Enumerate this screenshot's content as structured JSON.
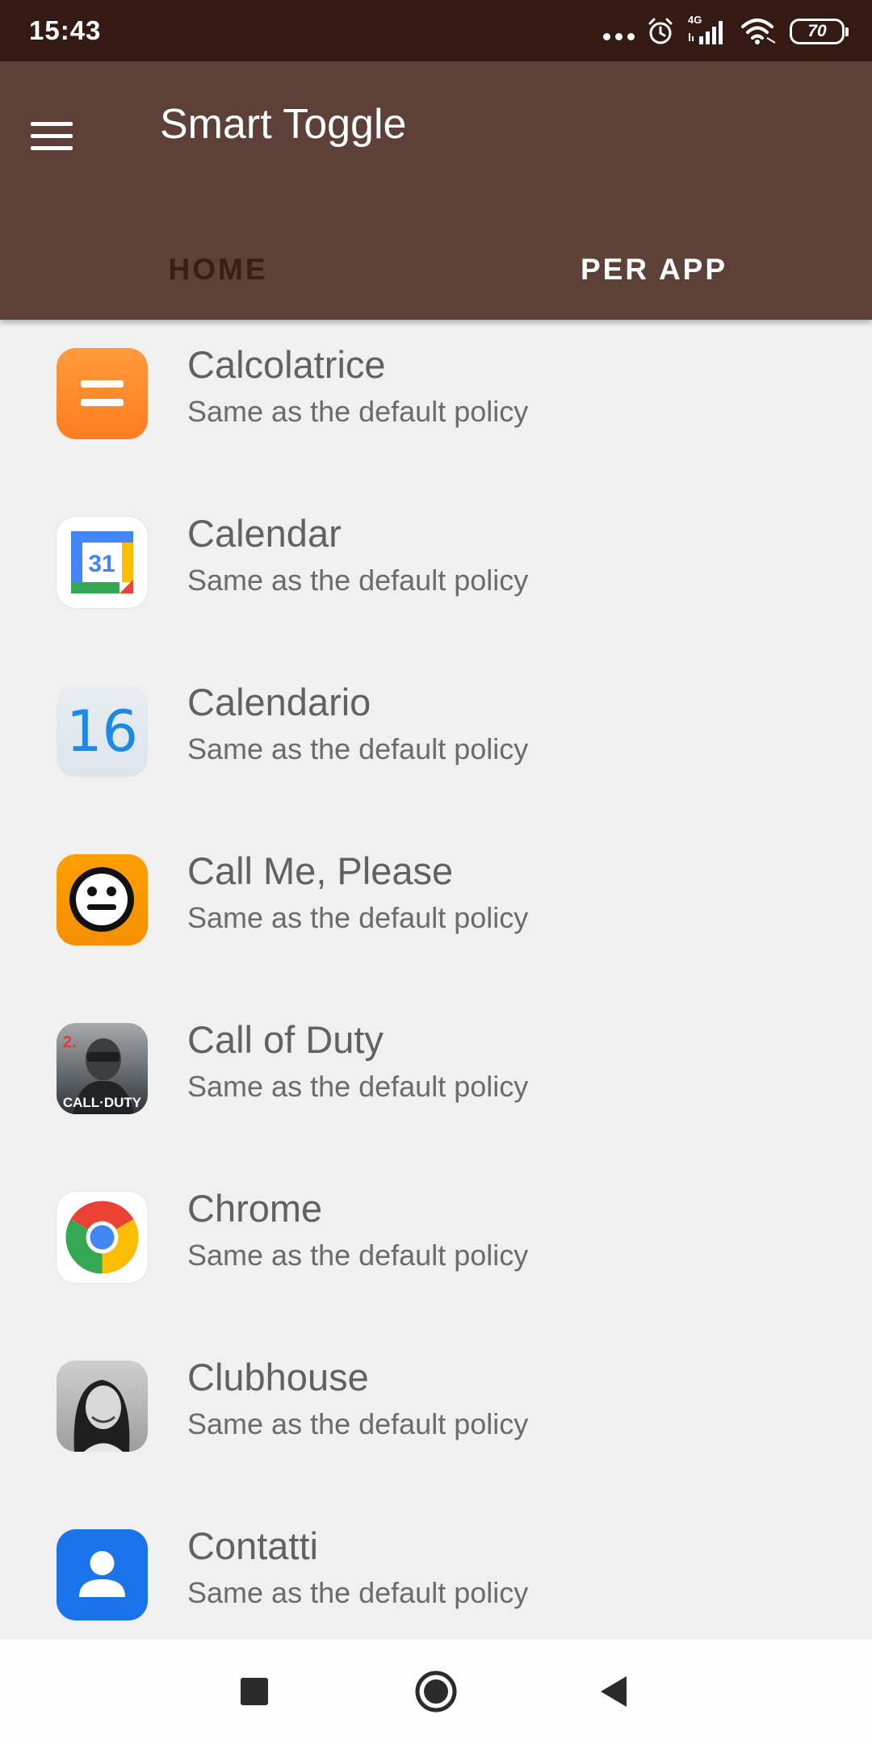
{
  "status_bar": {
    "time": "15:43",
    "network": "4G",
    "battery": "70"
  },
  "app_bar": {
    "title": "Smart Toggle",
    "tabs": [
      {
        "label": "HOME",
        "selected": false
      },
      {
        "label": "PER APP",
        "selected": true
      }
    ]
  },
  "apps": [
    {
      "name": "Calcolatrice",
      "policy": "Same as the default policy",
      "icon": "calculator-icon"
    },
    {
      "name": "Calendar",
      "policy": "Same as the default policy",
      "icon": "google-calendar-icon",
      "icon_text": "31"
    },
    {
      "name": "Calendario",
      "policy": "Same as the default policy",
      "icon": "calendar-icon",
      "icon_text": "16"
    },
    {
      "name": "Call Me, Please",
      "policy": "Same as the default policy",
      "icon": "smiley-face-icon"
    },
    {
      "name": "Call of Duty",
      "policy": "Same as the default policy",
      "icon": "call-of-duty-icon",
      "icon_text": "CALL·DUTY"
    },
    {
      "name": "Chrome",
      "policy": "Same as the default policy",
      "icon": "chrome-icon"
    },
    {
      "name": "Clubhouse",
      "policy": "Same as the default policy",
      "icon": "clubhouse-icon"
    },
    {
      "name": "Contatti",
      "policy": "Same as the default policy",
      "icon": "contacts-icon"
    }
  ],
  "colors": {
    "status_bar": "#351a13",
    "app_bar": "#5d4037",
    "list_background": "#f0f0f0"
  }
}
